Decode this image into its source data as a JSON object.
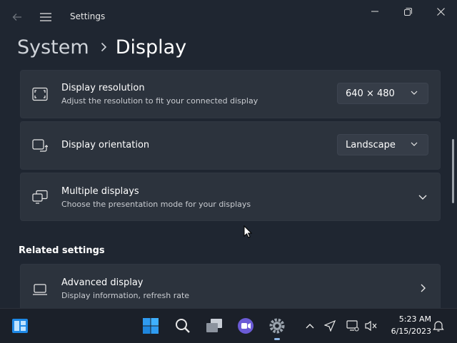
{
  "window": {
    "app_title": "Settings"
  },
  "breadcrumb": {
    "parent": "System",
    "separator_icon": "chevron-right-icon",
    "current": "Display"
  },
  "cards": {
    "resolution": {
      "title": "Display resolution",
      "subtitle": "Adjust the resolution to fit your connected display",
      "value": "640 × 480",
      "icon": "display-resolution-icon"
    },
    "orientation": {
      "title": "Display orientation",
      "value": "Landscape",
      "icon": "display-orientation-icon"
    },
    "multiple": {
      "title": "Multiple displays",
      "subtitle": "Choose the presentation mode for your displays",
      "icon": "multiple-displays-icon"
    },
    "advanced": {
      "title": "Advanced display",
      "subtitle": "Display information, refresh rate",
      "icon": "laptop-icon"
    }
  },
  "related_settings": {
    "heading": "Related settings"
  },
  "taskbar": {
    "time": "5:23 AM",
    "date": "6/15/2023",
    "icons": [
      "widgets-icon",
      "start-icon",
      "search-icon",
      "task-view-icon",
      "chat-icon",
      "settings-icon"
    ],
    "tray_icons": [
      "chevron-up-icon",
      "location-icon",
      "network-icon",
      "volume-muted-icon",
      "notification-icon"
    ]
  },
  "colors": {
    "background": "#1f2631",
    "card": "#2c333d",
    "taskbar": "#1b2029",
    "accent": "#4aa3ff"
  }
}
